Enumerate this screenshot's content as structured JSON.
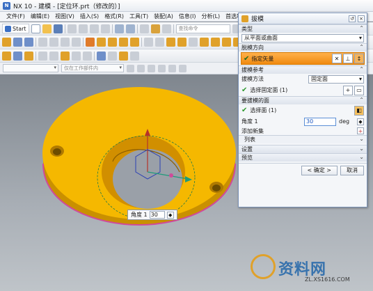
{
  "window": {
    "title": "NX 10 - 建模 - [定位环.prt（修改的）]"
  },
  "menu": [
    "文件(F)",
    "编辑(E)",
    "视图(V)",
    "插入(S)",
    "格式(R)",
    "工具(T)",
    "装配(A)",
    "信息(I)",
    "分析(L)",
    "首选项(P)"
  ],
  "toolbar": {
    "start_label": "Start",
    "search_placeholder": "查找命令"
  },
  "filterbar": {
    "selection_filter": "仅在工作部件内"
  },
  "dialog": {
    "title": "拔模",
    "type_section": "类型",
    "type_value": "从平面或曲面",
    "direction_section": "脱模方向",
    "direction_value": "指定矢量",
    "ref_section": "拔模参考",
    "ref_method_label": "拔模方法",
    "ref_method_value": "固定面",
    "select_fixed_face": "选择固定面 (1)",
    "draft_face_section": "要拔模的面",
    "select_face": "选择面 (1)",
    "angle_label": "角度 1",
    "angle_value": "30",
    "angle_unit": "deg",
    "add_new_set": "添加新集",
    "list_label": "列表",
    "settings_section": "设置",
    "preview_section": "预览",
    "ok_label": "< 确定 >",
    "cancel_label": "取消"
  },
  "angle_tip": {
    "label": "角度 1",
    "value": "30"
  },
  "watermark": {
    "text": "资料网",
    "sub": "ZL.XS1616.COM"
  },
  "colors": {
    "part": "#f5b800",
    "part_dark": "#c98a00",
    "edge": "#d04a9a",
    "accent": "#f08a10"
  }
}
